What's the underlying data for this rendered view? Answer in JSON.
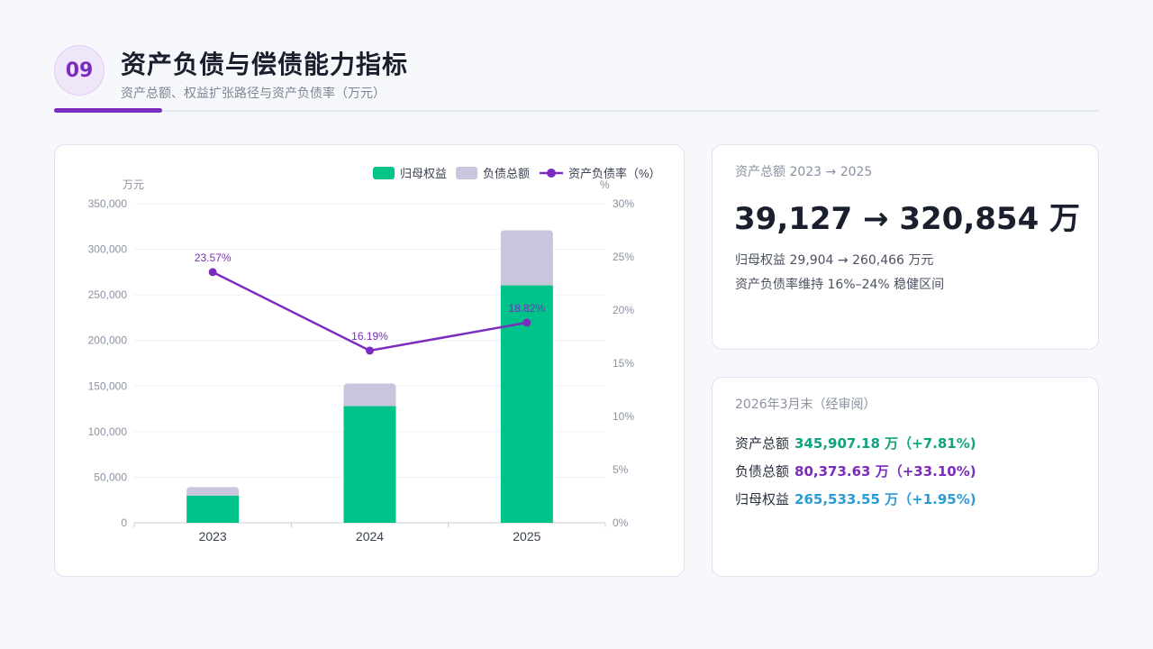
{
  "header": {
    "badge": "09",
    "title": "资产负债与偿债能力指标",
    "subtitle": "资产总额、权益扩张路径与资产负债率（万元）"
  },
  "colors": {
    "accent": "#7b2cbf",
    "equity": "#00c389",
    "liabilities": "#c9c5dd",
    "ratio": "#7b2cbf",
    "assets_text": "#10a37f",
    "liab_text": "#7b2cbf",
    "equity_text": "#2b9bd6"
  },
  "chart_data": {
    "type": "bar",
    "stacked": true,
    "categories": [
      "2023",
      "2024",
      "2025"
    ],
    "series": [
      {
        "name": "归母权益",
        "kind": "bar",
        "values": [
          29904,
          128000,
          260466
        ]
      },
      {
        "name": "负债总额",
        "kind": "bar",
        "values": [
          9223,
          24800,
          60388
        ]
      },
      {
        "name": "资产负债率（%）",
        "kind": "line",
        "axis": "right",
        "values": [
          23.57,
          16.19,
          18.82
        ]
      }
    ],
    "line_labels": [
      "23.57%",
      "16.19%",
      "18.82%"
    ],
    "ylabel": "万元",
    "y2label": "%",
    "ylim": [
      0,
      350000
    ],
    "y2lim": [
      0,
      30
    ],
    "yticks": [
      "0",
      "50,000",
      "100,000",
      "150,000",
      "200,000",
      "250,000",
      "300,000",
      "350,000"
    ],
    "y2ticks": [
      "0%",
      "5%",
      "10%",
      "15%",
      "20%",
      "25%",
      "30%"
    ],
    "legend_position": "top-right",
    "grid": true
  },
  "kpi": {
    "label": "资产总额 2023 → 2025",
    "value": "39,127 → 320,854 万",
    "line1": "归母权益 29,904 → 260,466 万元",
    "line2": "资产负债率维持 16%–24% 稳健区间"
  },
  "detail": {
    "label": "2026年3月末（经审阅）",
    "rows": [
      {
        "name": "资产总额",
        "value": "345,907.18 万（+7.81%)"
      },
      {
        "name": "负债总额",
        "value": "80,373.63 万（+33.10%)"
      },
      {
        "name": "归母权益",
        "value": "265,533.55 万（+1.95%)"
      }
    ]
  }
}
